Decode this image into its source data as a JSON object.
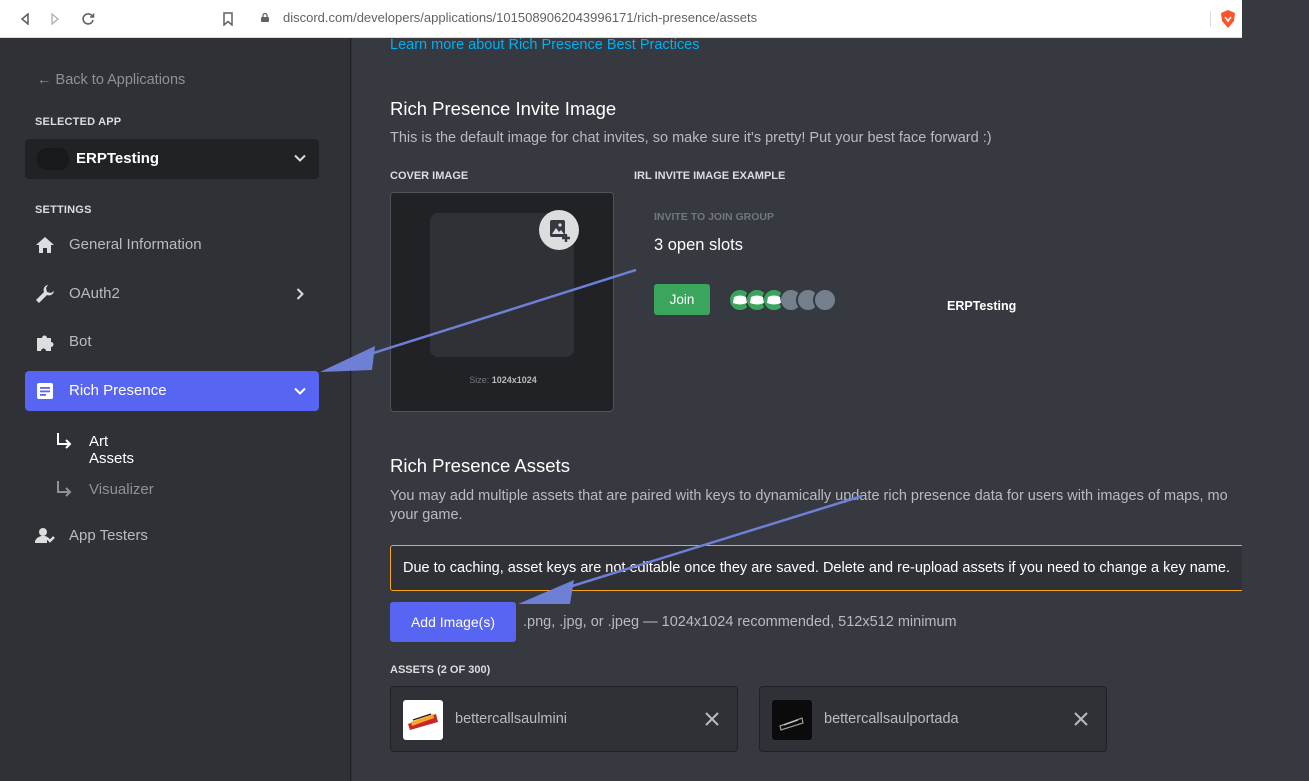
{
  "browser": {
    "url": "discord.com/developers/applications/1015089062043996171/rich-presence/assets"
  },
  "sidebar": {
    "back_label": "← Back to Applications",
    "selected_app_label": "SELECTED APP",
    "app_name": "ERPTesting",
    "settings_label": "SETTINGS",
    "items": [
      {
        "label": "General Information",
        "icon": "home-icon"
      },
      {
        "label": "OAuth2",
        "icon": "wrench-icon"
      },
      {
        "label": "Bot",
        "icon": "puzzle-icon"
      },
      {
        "label": "Rich Presence",
        "icon": "document-icon"
      },
      {
        "label": "App Testers",
        "icon": "user-test-icon"
      }
    ],
    "sub_items": [
      {
        "label": "Art Assets"
      },
      {
        "label": "Visualizer"
      }
    ]
  },
  "main": {
    "top_link": "Learn more about Rich Presence Best Practices",
    "invite": {
      "title": "Rich Presence Invite Image",
      "description": "This is the default image for chat invites, so make sure it's pretty! Put your best face forward :)",
      "cover_label": "COVER IMAGE",
      "example_label": "IRL INVITE IMAGE EXAMPLE",
      "size_prefix": "Size:",
      "size_value": "1024x1024",
      "invite_label": "INVITE TO JOIN GROUP",
      "open_slots": "3 open slots",
      "join_label": "Join",
      "app_name": "ERPTesting"
    },
    "assets": {
      "title": "Rich Presence Assets",
      "description_line1": "You may add multiple assets that are paired with keys to dynamically update rich presence data for users with images of maps, mo",
      "description_line2": "your game.",
      "notice": "Due to caching, asset keys are not editable once they are saved. Delete and re-upload assets if you need to change a key name.",
      "add_button": "Add Image(s)",
      "hint": ".png, .jpg, or .jpeg — 1024x1024 recommended, 512x512 minimum",
      "list_label": "ASSETS (2 OF 300)",
      "items": [
        {
          "name": "bettercallsaulmini"
        },
        {
          "name": "bettercallsaulportada"
        }
      ]
    }
  },
  "colors": {
    "accent": "#5865f2",
    "success": "#3ba55d",
    "warning_border": "#faa61a",
    "link": "#00aff4",
    "annotation_arrow": "#6e7fd6"
  }
}
